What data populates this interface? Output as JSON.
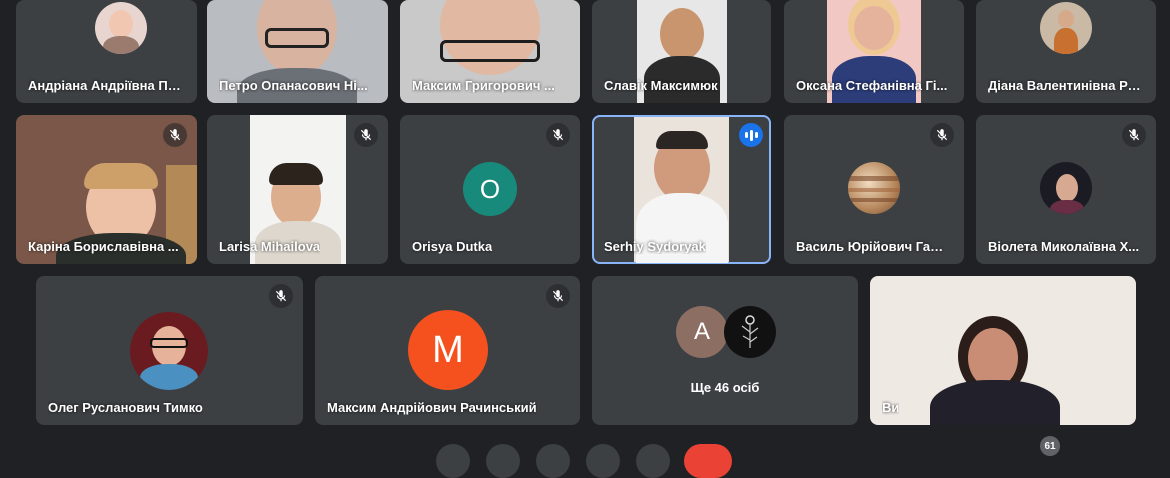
{
  "participants": {
    "p1": {
      "name": "Андріана Андріївна По..."
    },
    "p2": {
      "name": "Петро Опанасович Ні..."
    },
    "p3": {
      "name": "Максим Григорович ..."
    },
    "p4": {
      "name": "Славік Максимюк"
    },
    "p5": {
      "name": "Оксана Стефанівна Гі..."
    },
    "p6": {
      "name": "Діана Валентинівна Ра..."
    },
    "p7": {
      "name": "Каріна Бориславівна ..."
    },
    "p8": {
      "name": "Larisa Mihailova"
    },
    "p9": {
      "name": "Orisya Dutka",
      "initial": "O",
      "avatar_color": "#188a7b"
    },
    "p10": {
      "name": "Serhiy Sydoryak",
      "state": "speaking"
    },
    "p11": {
      "name": "Василь Юрійович Ганд..."
    },
    "p12": {
      "name": "Віолета Миколаївна Х..."
    },
    "p13": {
      "name": "Олег Русланович Тимко"
    },
    "p14": {
      "name": "Максим Андрійович Рачинський",
      "initial": "M",
      "avatar_color": "#f4511e"
    },
    "p15": {
      "name": "Ще 46 осіб",
      "initial": "A",
      "avatar_color": "#8d6e63"
    },
    "p16": {
      "name": "Ви"
    }
  },
  "participants_count_badge": "61",
  "icons": {
    "muted": "mic-off-icon",
    "speaking": "audio-level-icon"
  },
  "colors": {
    "background": "#202124",
    "tile": "#3c4043",
    "active_border": "#8ab4f8",
    "speaking": "#1a73e8"
  }
}
